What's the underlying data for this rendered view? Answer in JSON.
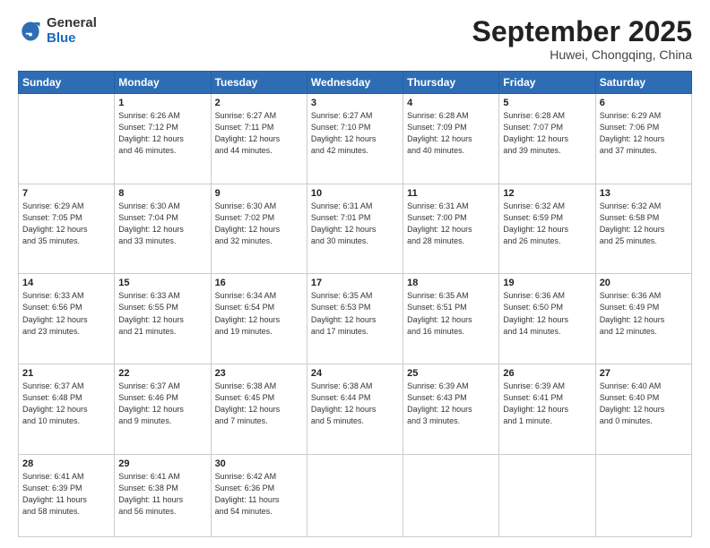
{
  "header": {
    "logo_general": "General",
    "logo_blue": "Blue",
    "month_title": "September 2025",
    "location": "Huwei, Chongqing, China"
  },
  "days_of_week": [
    "Sunday",
    "Monday",
    "Tuesday",
    "Wednesday",
    "Thursday",
    "Friday",
    "Saturday"
  ],
  "weeks": [
    [
      {
        "num": "",
        "info": ""
      },
      {
        "num": "1",
        "info": "Sunrise: 6:26 AM\nSunset: 7:12 PM\nDaylight: 12 hours\nand 46 minutes."
      },
      {
        "num": "2",
        "info": "Sunrise: 6:27 AM\nSunset: 7:11 PM\nDaylight: 12 hours\nand 44 minutes."
      },
      {
        "num": "3",
        "info": "Sunrise: 6:27 AM\nSunset: 7:10 PM\nDaylight: 12 hours\nand 42 minutes."
      },
      {
        "num": "4",
        "info": "Sunrise: 6:28 AM\nSunset: 7:09 PM\nDaylight: 12 hours\nand 40 minutes."
      },
      {
        "num": "5",
        "info": "Sunrise: 6:28 AM\nSunset: 7:07 PM\nDaylight: 12 hours\nand 39 minutes."
      },
      {
        "num": "6",
        "info": "Sunrise: 6:29 AM\nSunset: 7:06 PM\nDaylight: 12 hours\nand 37 minutes."
      }
    ],
    [
      {
        "num": "7",
        "info": "Sunrise: 6:29 AM\nSunset: 7:05 PM\nDaylight: 12 hours\nand 35 minutes."
      },
      {
        "num": "8",
        "info": "Sunrise: 6:30 AM\nSunset: 7:04 PM\nDaylight: 12 hours\nand 33 minutes."
      },
      {
        "num": "9",
        "info": "Sunrise: 6:30 AM\nSunset: 7:02 PM\nDaylight: 12 hours\nand 32 minutes."
      },
      {
        "num": "10",
        "info": "Sunrise: 6:31 AM\nSunset: 7:01 PM\nDaylight: 12 hours\nand 30 minutes."
      },
      {
        "num": "11",
        "info": "Sunrise: 6:31 AM\nSunset: 7:00 PM\nDaylight: 12 hours\nand 28 minutes."
      },
      {
        "num": "12",
        "info": "Sunrise: 6:32 AM\nSunset: 6:59 PM\nDaylight: 12 hours\nand 26 minutes."
      },
      {
        "num": "13",
        "info": "Sunrise: 6:32 AM\nSunset: 6:58 PM\nDaylight: 12 hours\nand 25 minutes."
      }
    ],
    [
      {
        "num": "14",
        "info": "Sunrise: 6:33 AM\nSunset: 6:56 PM\nDaylight: 12 hours\nand 23 minutes."
      },
      {
        "num": "15",
        "info": "Sunrise: 6:33 AM\nSunset: 6:55 PM\nDaylight: 12 hours\nand 21 minutes."
      },
      {
        "num": "16",
        "info": "Sunrise: 6:34 AM\nSunset: 6:54 PM\nDaylight: 12 hours\nand 19 minutes."
      },
      {
        "num": "17",
        "info": "Sunrise: 6:35 AM\nSunset: 6:53 PM\nDaylight: 12 hours\nand 17 minutes."
      },
      {
        "num": "18",
        "info": "Sunrise: 6:35 AM\nSunset: 6:51 PM\nDaylight: 12 hours\nand 16 minutes."
      },
      {
        "num": "19",
        "info": "Sunrise: 6:36 AM\nSunset: 6:50 PM\nDaylight: 12 hours\nand 14 minutes."
      },
      {
        "num": "20",
        "info": "Sunrise: 6:36 AM\nSunset: 6:49 PM\nDaylight: 12 hours\nand 12 minutes."
      }
    ],
    [
      {
        "num": "21",
        "info": "Sunrise: 6:37 AM\nSunset: 6:48 PM\nDaylight: 12 hours\nand 10 minutes."
      },
      {
        "num": "22",
        "info": "Sunrise: 6:37 AM\nSunset: 6:46 PM\nDaylight: 12 hours\nand 9 minutes."
      },
      {
        "num": "23",
        "info": "Sunrise: 6:38 AM\nSunset: 6:45 PM\nDaylight: 12 hours\nand 7 minutes."
      },
      {
        "num": "24",
        "info": "Sunrise: 6:38 AM\nSunset: 6:44 PM\nDaylight: 12 hours\nand 5 minutes."
      },
      {
        "num": "25",
        "info": "Sunrise: 6:39 AM\nSunset: 6:43 PM\nDaylight: 12 hours\nand 3 minutes."
      },
      {
        "num": "26",
        "info": "Sunrise: 6:39 AM\nSunset: 6:41 PM\nDaylight: 12 hours\nand 1 minute."
      },
      {
        "num": "27",
        "info": "Sunrise: 6:40 AM\nSunset: 6:40 PM\nDaylight: 12 hours\nand 0 minutes."
      }
    ],
    [
      {
        "num": "28",
        "info": "Sunrise: 6:41 AM\nSunset: 6:39 PM\nDaylight: 11 hours\nand 58 minutes."
      },
      {
        "num": "29",
        "info": "Sunrise: 6:41 AM\nSunset: 6:38 PM\nDaylight: 11 hours\nand 56 minutes."
      },
      {
        "num": "30",
        "info": "Sunrise: 6:42 AM\nSunset: 6:36 PM\nDaylight: 11 hours\nand 54 minutes."
      },
      {
        "num": "",
        "info": ""
      },
      {
        "num": "",
        "info": ""
      },
      {
        "num": "",
        "info": ""
      },
      {
        "num": "",
        "info": ""
      }
    ]
  ]
}
